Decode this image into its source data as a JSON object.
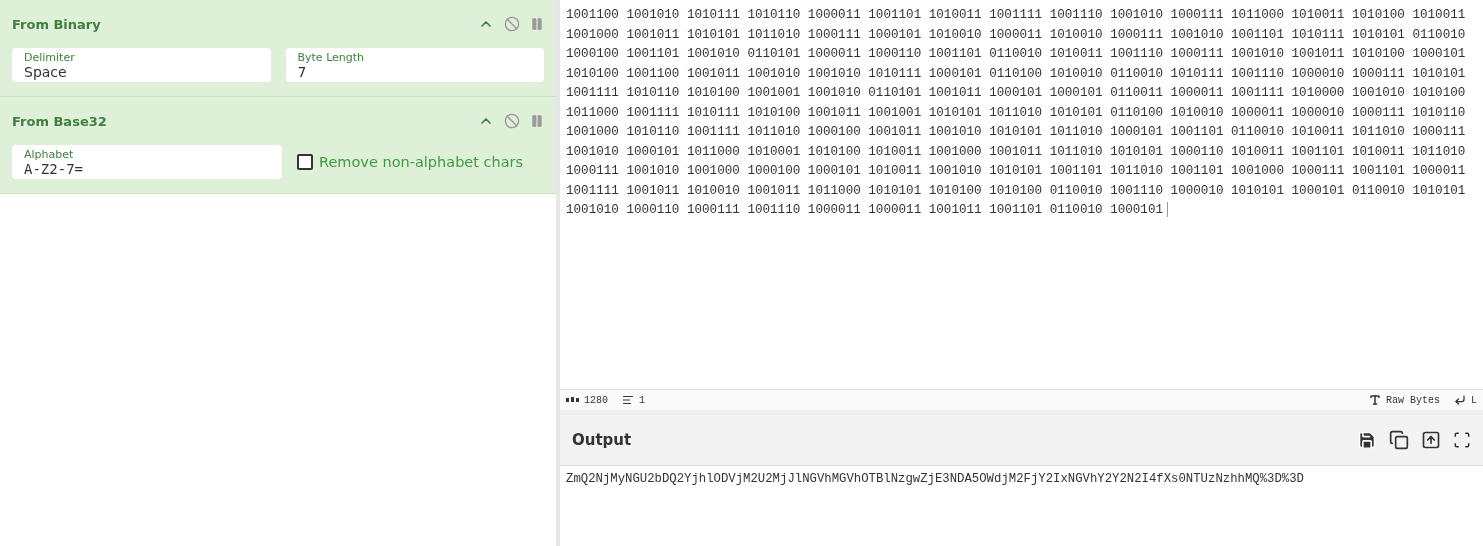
{
  "recipe": [
    {
      "title": "From Binary",
      "args": [
        {
          "kind": "field",
          "label": "Delimiter",
          "value": "Space"
        },
        {
          "kind": "field",
          "label": "Byte Length",
          "value": "7"
        }
      ]
    },
    {
      "title": "From Base32",
      "args": [
        {
          "kind": "field",
          "label": "Alphabet",
          "value": "A-Z2-7="
        },
        {
          "kind": "checkbox",
          "label": "Remove non-alphabet chars",
          "checked": false
        }
      ]
    }
  ],
  "input": {
    "lines": [
      "1001100 1001010 1010111 1010110 1000011 1001101 1010011 1001111 1001110 1001010 1000111 1011000 1010011 1010100 1010011",
      "1001000 1001011 1010101 1011010 1000111 1000101 1010010 1000011 1010010 1000111 1001010 1001101 1010111 1010101 0110010",
      "1000100 1001101 1001010 0110101 1000011 1000110 1001101 0110010 1010011 1001110 1000111 1001010 1001011 1010100 1000101",
      "1010100 1001100 1001011 1001010 1001010 1010111 1000101 0110100 1010010 0110010 1010111 1001110 1000010 1000111 1010101",
      "1001111 1010110 1010100 1001001 1001010 0110101 1001011 1000101 1000101 0110011 1000011 1001111 1010000 1001010 1010100",
      "1011000 1001111 1010111 1010100 1001011 1001001 1010101 1011010 1010101 0110100 1010010 1000011 1000010 1000111 1010110",
      "1001000 1010110 1001111 1011010 1000100 1001011 1001010 1010101 1011010 1000101 1001101 0110010 1010011 1011010 1000111",
      "1001010 1000101 1011000 1010001 1010100 1010011 1001000 1001011 1011010 1010101 1000110 1010011 1001101 1010011 1011010",
      "1000111 1001010 1001000 1000100 1000101 1010011 1001010 1010101 1001101 1011010 1001101 1001000 1000111 1001101 1000011",
      "1001111 1001011 1010010 1001011 1011000 1010101 1010100 1010100 0110010 1001110 1000010 1010101 1000101 0110010 1010101",
      "1001010 1000110 1000111 1001110 1000011 1000011 1001011 1001101 0110010 1000101"
    ]
  },
  "input_status": {
    "length": "1280",
    "lines": "1",
    "encoding": "Raw Bytes",
    "line_ending": "L"
  },
  "output": {
    "title": "Output",
    "text": "ZmQ2NjMyNGU2bDQ2YjhlODVjM2U2MjJlNGVhMGVhOTBlNzgwZjE3NDA5OWdjM2FjY2IxNGVhY2Y2N2I4fXs0NTUzNzhhMQ%3D%3D"
  }
}
